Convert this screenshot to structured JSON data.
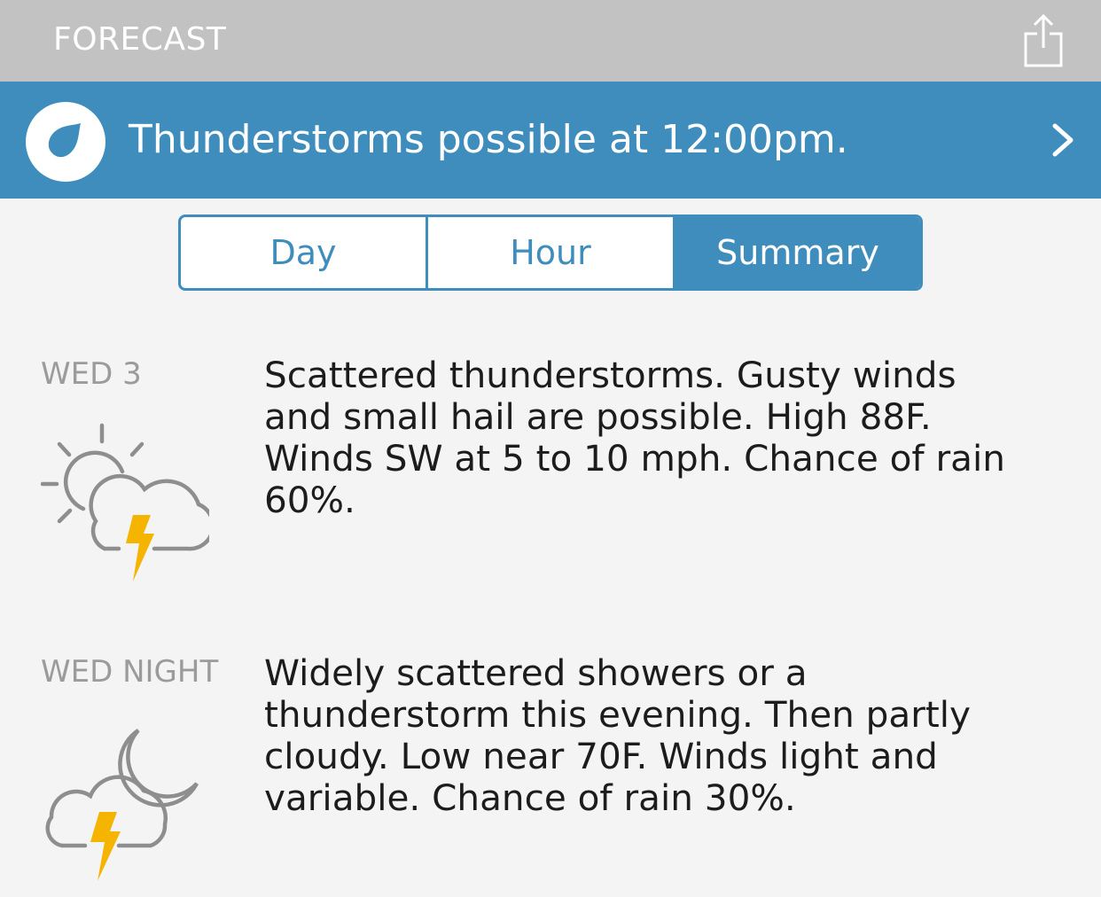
{
  "header": {
    "title": "FORECAST",
    "share_icon": "share-icon"
  },
  "alert": {
    "icon": "raindrop-icon",
    "text": "Thunderstorms possible at 12:00pm.",
    "chevron_icon": "chevron-right-icon"
  },
  "tabs": [
    {
      "label": "Day",
      "active": false
    },
    {
      "label": "Hour",
      "active": false
    },
    {
      "label": "Summary",
      "active": true
    }
  ],
  "forecast": [
    {
      "label": "WED 3",
      "icon": "partly-sunny-thunderstorm-icon",
      "lines": [
        "Scattered thunderstorms. Gusty winds",
        "and small hail are possible. High 88F.",
        "Winds SW at 5 to 10 mph. Chance of rain",
        "60%."
      ]
    },
    {
      "label": "WED NIGHT",
      "icon": "night-thunderstorm-icon",
      "lines": [
        "Widely scattered showers or a",
        "thunderstorm this evening. Then partly",
        "cloudy. Low near 70F. Winds light and",
        "variable. Chance of rain 30%."
      ]
    }
  ],
  "colors": {
    "header_bg": "#c2c2c2",
    "accent": "#3e8dbd",
    "page_bg": "#f4f4f4",
    "label_gray": "#9b9b9b",
    "icon_gray": "#8e8e8e",
    "bolt_yellow": "#f4b400"
  }
}
